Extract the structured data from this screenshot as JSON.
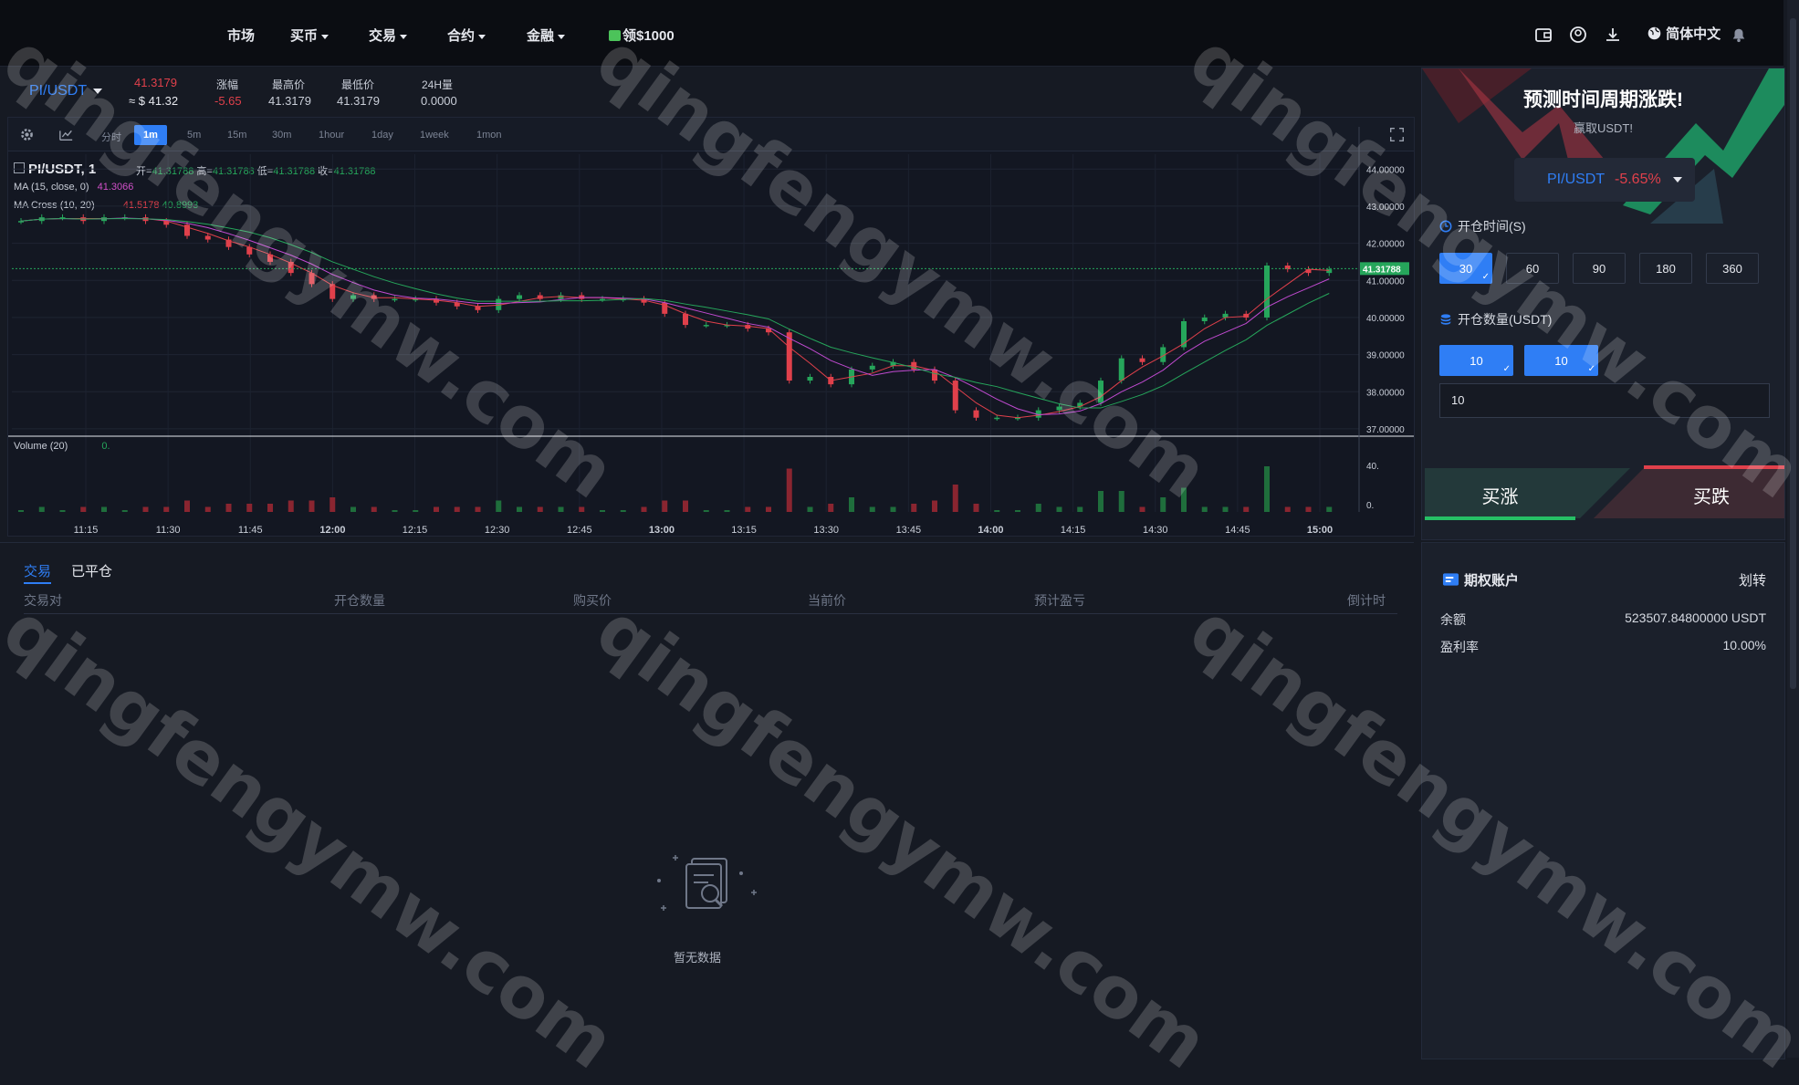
{
  "nav": {
    "items": [
      {
        "label": "市场",
        "dropdown": false
      },
      {
        "label": "买币",
        "dropdown": true
      },
      {
        "label": "交易",
        "dropdown": true
      },
      {
        "label": "合约",
        "dropdown": true
      },
      {
        "label": "金融",
        "dropdown": true
      }
    ],
    "promo_label": "领$1000",
    "language": "简体中文",
    "icons": [
      "wallet-icon",
      "user-icon",
      "download-icon",
      "globe-icon",
      "bell-icon"
    ]
  },
  "ticker": {
    "pair": "PI/USDT",
    "last_price": "41.3179",
    "usd_price": "≈ $ 41.32",
    "change_label": "涨幅",
    "change_value": "-5.65",
    "high_label": "最高价",
    "high_value": "41.3179",
    "low_label": "最低价",
    "low_value": "41.3179",
    "vol_label": "24H量",
    "vol_value": "0.0000"
  },
  "chart_toolbar": {
    "timeframes": [
      "分时",
      "1m",
      "5m",
      "15m",
      "30m",
      "1hour",
      "1day",
      "1week",
      "1mon"
    ],
    "active": "1m",
    "icons": [
      "settings-icon",
      "chart-type-icon",
      "fullscreen-icon"
    ]
  },
  "chart_legend": {
    "symbol": "PI/USDT, 1",
    "open_label": "开=",
    "open": "41.31788",
    "high_label": "高=",
    "high": "41.31788",
    "low_label": "低=",
    "low": "41.31788",
    "close_label": "收=",
    "close": "41.31788",
    "ma": "MA (15, close, 0)",
    "ma_value": "41.3066",
    "ma_cross": "MA Cross (10, 20)",
    "ma_cross_v1": "41.5178",
    "ma_cross_v2": "40.8993",
    "volume": "Volume (20)",
    "volume_value": "0."
  },
  "chart_data": {
    "type": "candlestick",
    "y_axis": [
      "44.00000",
      "43.00000",
      "42.00000",
      "41.00000",
      "40.00000",
      "39.00000",
      "38.00000",
      "37.00000"
    ],
    "ylim": [
      36.9,
      44.4
    ],
    "x_ticks": [
      "11:15",
      "11:30",
      "11:45",
      "12:00",
      "12:15",
      "12:30",
      "12:45",
      "13:00",
      "13:15",
      "13:30",
      "13:45",
      "14:00",
      "14:15",
      "14:30",
      "14:45",
      "15:00"
    ],
    "current_price_tag": "41.31788",
    "volume_axis": [
      "40.",
      "0."
    ],
    "close": [
      42.6,
      42.7,
      42.7,
      42.6,
      42.7,
      42.7,
      42.6,
      42.5,
      42.2,
      42.1,
      41.9,
      41.7,
      41.5,
      41.2,
      40.9,
      40.5,
      40.6,
      40.5,
      40.5,
      40.5,
      40.4,
      40.3,
      40.2,
      40.5,
      40.6,
      40.5,
      40.6,
      40.5,
      40.5,
      40.5,
      40.4,
      40.1,
      39.8,
      39.8,
      39.8,
      39.7,
      39.6,
      38.3,
      38.4,
      38.2,
      38.6,
      38.7,
      38.8,
      38.6,
      38.3,
      37.5,
      37.3,
      37.3,
      37.3,
      37.5,
      37.6,
      37.7,
      38.3,
      38.9,
      38.8,
      39.2,
      39.9,
      40.0,
      40.1,
      40.0,
      41.4,
      41.3,
      41.2,
      41.3
    ]
  },
  "trade_panel": {
    "promo_title": "预测时间周期涨跌!",
    "promo_sub": "赢取USDT!",
    "symbol": "PI/USDT",
    "symbol_change": "-5.65%",
    "time_label": "开仓时间(S)",
    "time_options": [
      "30",
      "60",
      "90",
      "180",
      "360"
    ],
    "time_selected": "30",
    "qty_label": "开仓数量(USDT)",
    "qty_options": [
      "10",
      "10"
    ],
    "qty_input": "10",
    "buy_up": "买涨",
    "buy_down": "买跌"
  },
  "orders": {
    "tabs": [
      "交易",
      "已平仓"
    ],
    "columns": [
      "交易对",
      "开仓数量",
      "购买价",
      "当前价",
      "预计盈亏",
      "倒计时"
    ],
    "empty_text": "暂无数据"
  },
  "account": {
    "title": "期权账户",
    "transfer": "划转",
    "balance_label": "余额",
    "balance_value": "523507.84800000 USDT",
    "profit_label": "盈利率",
    "profit_value": "10.00%"
  },
  "watermark": "qingfengymw.com",
  "colors": {
    "up": "#26a65b",
    "down": "#e0404b",
    "accent": "#2f7ef5",
    "bg": "#161a23"
  }
}
